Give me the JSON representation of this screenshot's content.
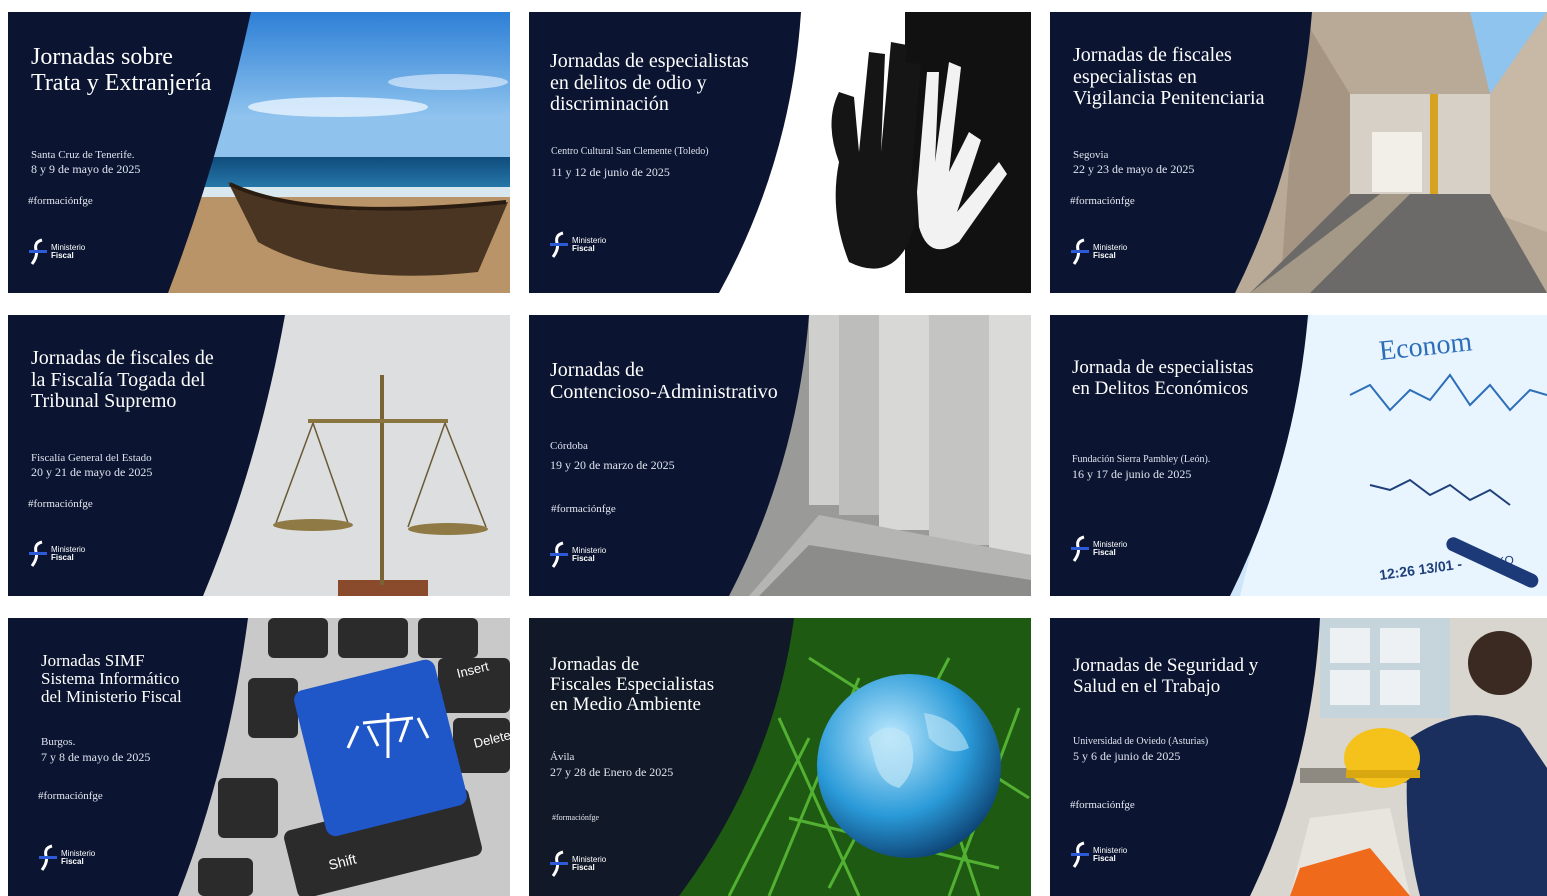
{
  "colors": {
    "navy": "#0b1430",
    "text": "#ffffff",
    "accent": "#2d5bd8"
  },
  "logo": {
    "line1": "Ministerio",
    "line2": "Fiscal",
    "icon": "ministerio-fiscal-logo-icon"
  },
  "cards": [
    {
      "title": "Jornadas sobre\nTrata y Extranjería",
      "place": "Santa Cruz de Tenerife.",
      "date": "8 y 9 de mayo de 2025",
      "hashtag": "#formaciónfge",
      "image": "boat-on-beach"
    },
    {
      "title": "Jornadas de especialistas\nen delitos de odio y\ndiscriminación",
      "place": "Centro Cultural San Clemente (Toledo)",
      "date": "11 y 12 de junio de 2025",
      "hashtag": "",
      "image": "handprints"
    },
    {
      "title": "Jornadas de fiscales\nespecialistas en\nVigilancia Penitenciaria",
      "place": "Segovia",
      "date": "22 y 23 de mayo de 2025",
      "hashtag": "#formaciónfge",
      "image": "concrete-corridor"
    },
    {
      "title": "Jornadas de fiscales de\nla Fiscalía Togada del\nTribunal Supremo",
      "place": "Fiscalía General del Estado",
      "date": "20 y 21 de mayo de 2025",
      "hashtag": "#formaciónfge",
      "image": "balance-scale"
    },
    {
      "title": "Jornadas de\nContencioso-Administrativo",
      "place": "Córdoba",
      "date": "19 y 20 de marzo de 2025",
      "hashtag": "#formaciónfge",
      "image": "stone-columns"
    },
    {
      "title": "Jornada de especialistas\nen Delitos Económicos",
      "place": "Fundación Sierra Pambley  (León).",
      "date": "16 y 17 de junio de 2025",
      "hashtag": "",
      "image": "economic-report",
      "image_text": {
        "word": "Econom",
        "time": "12:26 13/01 -",
        "tkp": "TKO"
      }
    },
    {
      "title": "Jornadas SIMF\nSistema Informático\ndel Ministerio Fiscal",
      "place": "Burgos.",
      "date": "7 y 8 de mayo de 2025",
      "hashtag": "#formaciónfge",
      "image": "keyboard-justice-key",
      "image_text": {
        "insert": "Insert",
        "delete": "Delete",
        "shift": "Shift"
      }
    },
    {
      "title": "Jornadas de\nFiscales Especialistas\nen Medio Ambiente",
      "place": "Ávila",
      "date": "27 y 28 de Enero de 2025",
      "hashtag": "#formaciónfge",
      "image": "glass-globe-grass"
    },
    {
      "title": "Jornadas de Seguridad y\nSalud en el Trabajo",
      "place": "Universidad de Oviedo (Asturias)",
      "date": "5 y 6 de junio de 2025",
      "hashtag": "#formaciónfge",
      "image": "worker-hard-hat"
    }
  ]
}
